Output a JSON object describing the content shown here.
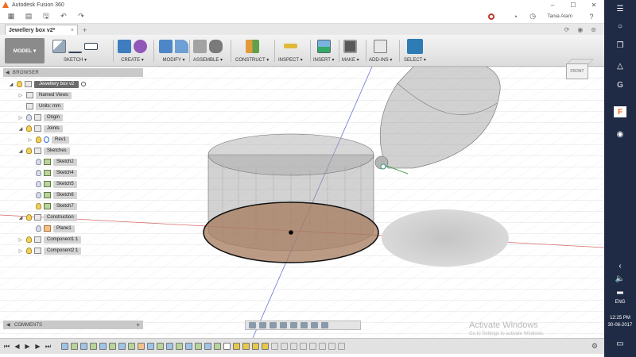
{
  "window": {
    "title": "Autodesk Fusion 360",
    "minimize": "‒",
    "maximize": "☐",
    "close": "✕"
  },
  "qab": {
    "user_name": "Tania Alam",
    "help": "?"
  },
  "document": {
    "tab_title": "Jewellery box v2*",
    "tab_close": "×",
    "tab_add": "+"
  },
  "ribbon": {
    "workspace": "MODEL ▾",
    "groups": {
      "sketch": "SKETCH ▾",
      "create": "CREATE ▾",
      "modify": "MODIFY ▾",
      "assemble": "ASSEMBLE ▾",
      "construct": "CONSTRUCT ▾",
      "inspect": "INSPECT ▾",
      "insert": "INSERT ▾",
      "make": "MAKE ▾",
      "addins": "ADD-INS ▾",
      "select": "SELECT ▾"
    }
  },
  "browser": {
    "title": "BROWSER",
    "items": [
      {
        "label": "Jewellery box v2"
      },
      {
        "label": "Named Views"
      },
      {
        "label": "Units: mm"
      },
      {
        "label": "Origin"
      },
      {
        "label": "Joints"
      },
      {
        "label": "Rev1"
      },
      {
        "label": "Sketches"
      },
      {
        "label": "Sketch2"
      },
      {
        "label": "Sketch4"
      },
      {
        "label": "Sketch5"
      },
      {
        "label": "Sketch6"
      },
      {
        "label": "Sketch7"
      },
      {
        "label": "Construction"
      },
      {
        "label": "Plane1"
      },
      {
        "label": "Component1:1"
      },
      {
        "label": "Component2:1"
      }
    ]
  },
  "viewcube": {
    "face": "FRONT"
  },
  "comments": {
    "label": "COMMENTS",
    "add": "+"
  },
  "watermark": {
    "title": "Activate Windows",
    "subtitle": "Go to Settings to activate Windows."
  },
  "timeline": {
    "first": "⏮",
    "prev": "◀",
    "play": "▶",
    "next": "▶",
    "last": "⏭",
    "settings": "⚙"
  },
  "taskbar": {
    "language": "ENG",
    "time": "12:25 PM",
    "date": "30-06-2017"
  },
  "colors": {
    "accent_blue": "#2e7bb5",
    "body_grey": "#8e8e8e",
    "base_brown": "#a57a5c",
    "taskbar": "#1f2a44"
  }
}
